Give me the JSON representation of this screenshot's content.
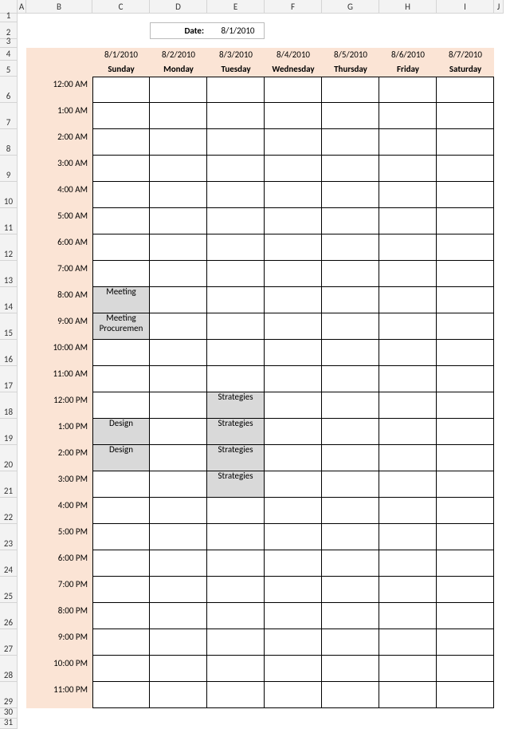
{
  "columns": [
    "A",
    "B",
    "C",
    "D",
    "E",
    "F",
    "G",
    "H",
    "I",
    "J"
  ],
  "rows": [
    "1",
    "2",
    "3",
    "4",
    "5",
    "6",
    "7",
    "8",
    "9",
    "10",
    "11",
    "12",
    "13",
    "14",
    "15",
    "16",
    "17",
    "18",
    "19",
    "20",
    "21",
    "22",
    "23",
    "24",
    "25",
    "26",
    "27",
    "28",
    "29",
    "30",
    "31"
  ],
  "dateLabel": "Date:",
  "dateValue": "8/1/2010",
  "days": [
    {
      "date": "8/1/2010",
      "name": "Sunday"
    },
    {
      "date": "8/2/2010",
      "name": "Monday"
    },
    {
      "date": "8/3/2010",
      "name": "Tuesday"
    },
    {
      "date": "8/4/2010",
      "name": "Wednesday"
    },
    {
      "date": "8/5/2010",
      "name": "Thursday"
    },
    {
      "date": "8/6/2010",
      "name": "Friday"
    },
    {
      "date": "8/7/2010",
      "name": "Saturday"
    }
  ],
  "times": [
    "12:00 AM",
    "1:00 AM",
    "2:00 AM",
    "3:00 AM",
    "4:00 AM",
    "5:00 AM",
    "6:00 AM",
    "7:00 AM",
    "8:00 AM",
    "9:00 AM",
    "10:00 AM",
    "11:00 AM",
    "12:00 PM",
    "1:00 PM",
    "2:00 PM",
    "3:00 PM",
    "4:00 PM",
    "5:00 PM",
    "6:00 PM",
    "7:00 PM",
    "8:00 PM",
    "9:00 PM",
    "10:00 PM",
    "11:00 PM"
  ],
  "events": {
    "r8c0": "Meeting",
    "r9c0": "Meeting Procuremen",
    "r12c2": "Strategies",
    "r13c0": "Design",
    "r13c2": "Strategies",
    "r14c0": "Design",
    "r14c2": "Strategies",
    "r15c2": "Strategies"
  }
}
